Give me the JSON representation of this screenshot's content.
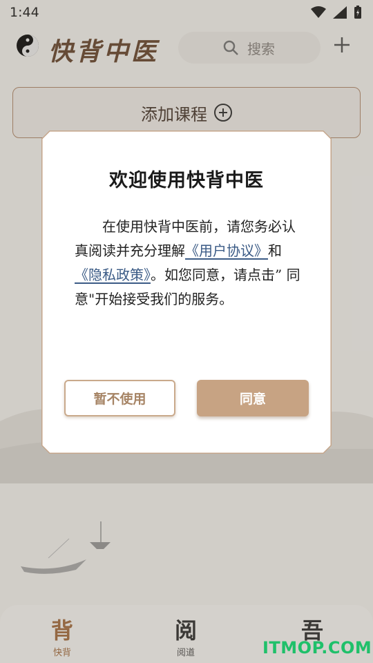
{
  "status_bar": {
    "time": "1:44"
  },
  "header": {
    "app_title": "快背中医",
    "search_placeholder": "搜索",
    "logo_icon": "yin-yang-icon"
  },
  "main": {
    "add_course_label": "添加课程"
  },
  "bottom_nav": {
    "items": [
      {
        "glyph": "背",
        "label": "快背",
        "active": true
      },
      {
        "glyph": "阅",
        "label": "阅道",
        "active": false
      },
      {
        "glyph": "吾",
        "label": "",
        "active": false
      }
    ]
  },
  "dialog": {
    "title": "欢迎使用快背中医",
    "body_part1": "在使用快背中医前，请您务必认真阅读并充分理解",
    "user_agreement_link": "《用户协议》",
    "body_and": "和",
    "privacy_link": "《隐私政策》",
    "body_part2": "。如您同意，请点击” 同意\"开始接受我们的服务。",
    "decline_label": "暂不使用",
    "agree_label": "同意"
  },
  "watermark": "ITMOP.COM",
  "colors": {
    "accent": "#c7a383",
    "link": "#3a5a85",
    "brand_brown": "#a46f43",
    "watermark_green": "#1fc06a"
  }
}
